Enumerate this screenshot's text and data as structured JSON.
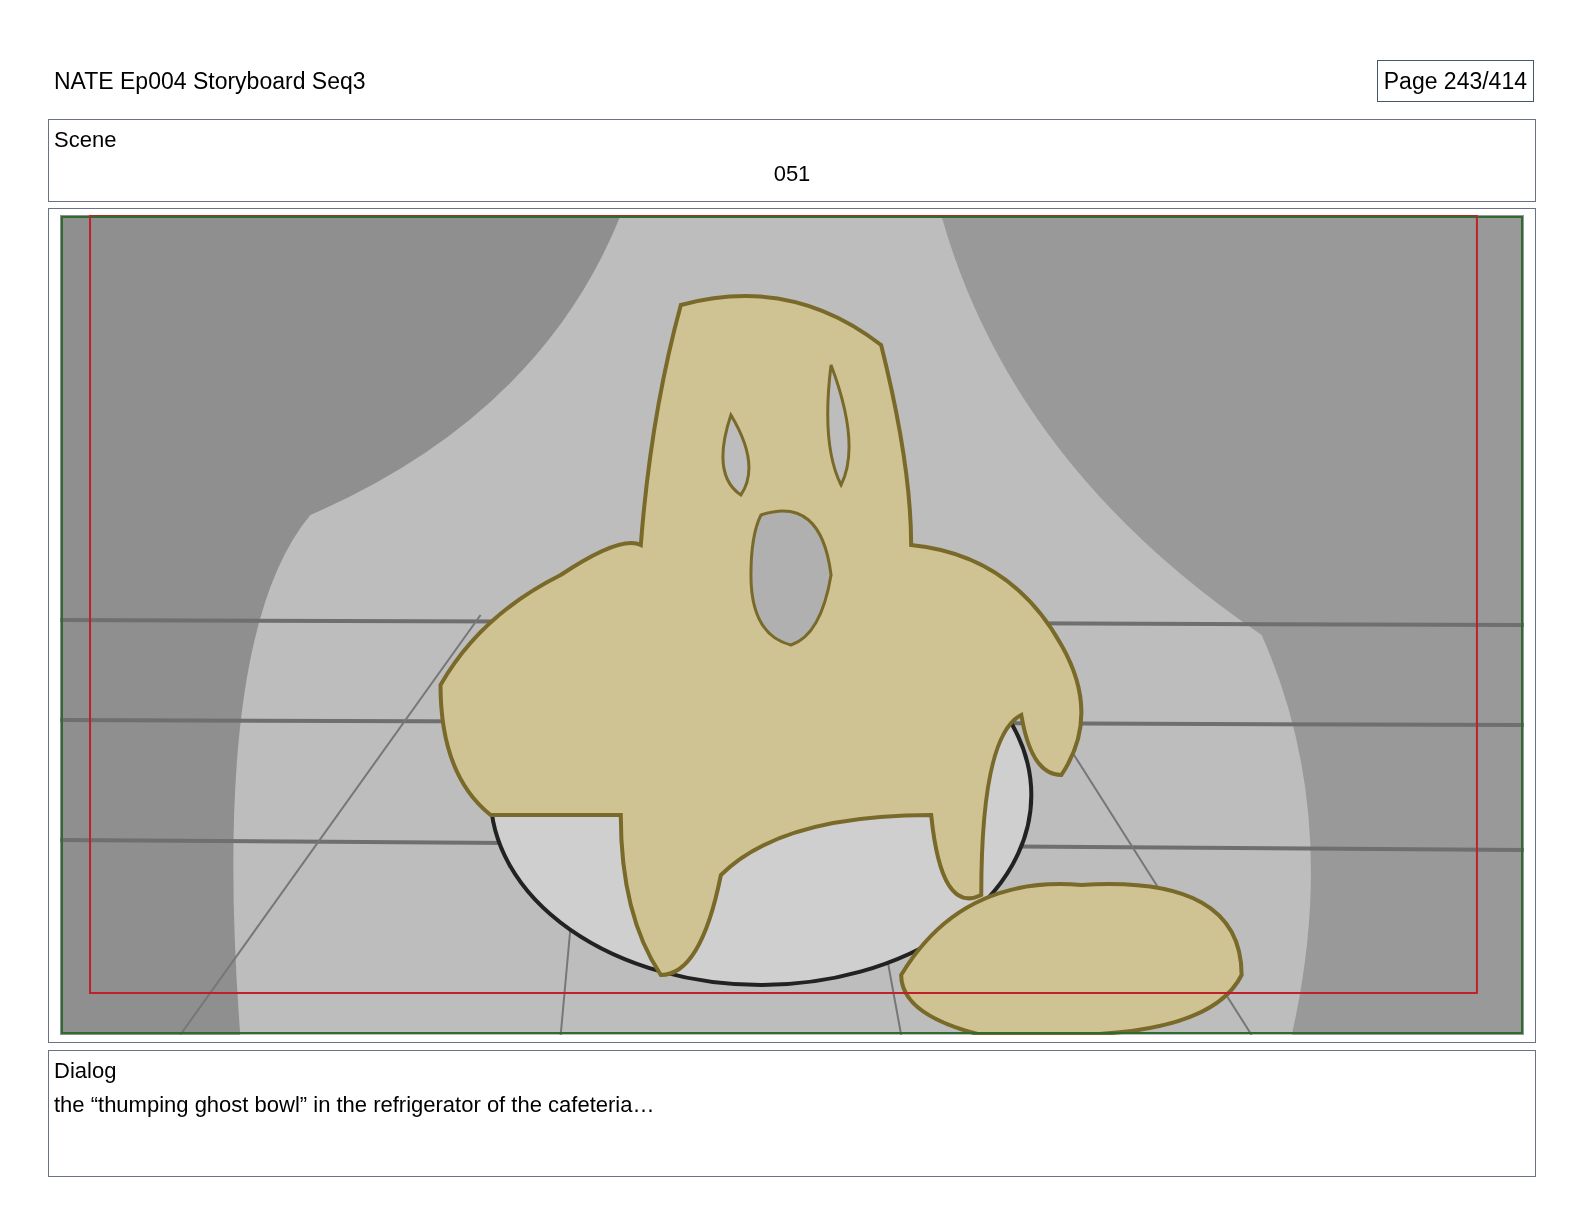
{
  "header": {
    "title": "NATE Ep004 Storyboard Seq3",
    "page": "Page 243/414"
  },
  "scene": {
    "label": "Scene",
    "number": "051"
  },
  "dialog": {
    "label": "Dialog",
    "text": "the “thumping ghost bowl” in the refrigerator of the cafeteria…"
  }
}
